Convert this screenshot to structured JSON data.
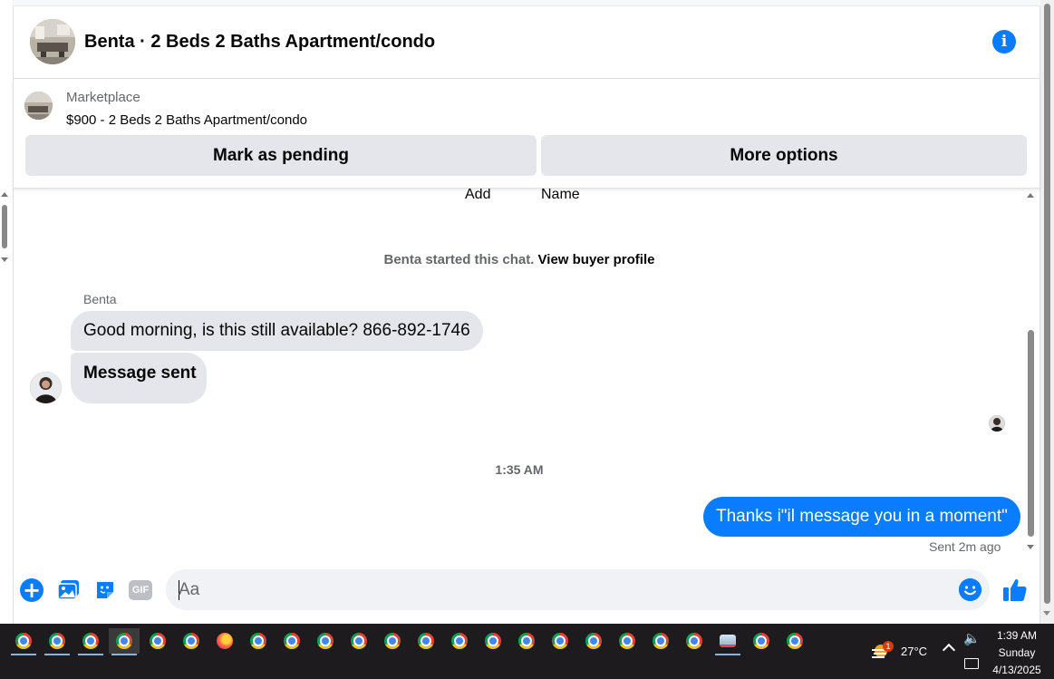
{
  "header": {
    "title": "Benta · 2 Beds 2 Baths Apartment/condo"
  },
  "listing": {
    "source": "Marketplace",
    "price_title": "$900 - 2 Beds 2 Baths Apartment/condo",
    "mark_pending_label": "Mark as pending",
    "more_options_label": "More options"
  },
  "conversation": {
    "cut_labels": [
      "Add",
      "Name"
    ],
    "chat_started_text": "Benta started this chat.",
    "view_profile_link": "View buyer profile",
    "sender_name": "Benta",
    "incoming": [
      "Good morning, is this still available? 866-892-1746",
      "Message sent"
    ],
    "timestamp": "1:35 AM",
    "outgoing": "Thanks i\"il message you in a moment\"",
    "sent_status": "Sent 2m ago"
  },
  "composer": {
    "placeholder": "Aa",
    "gif_label": "GIF"
  },
  "taskbar": {
    "badge_count": "1",
    "temperature": "27°C",
    "time": "1:39 AM",
    "day": "Sunday",
    "date": "4/13/2025"
  },
  "colors": {
    "accent": "#0a7cff",
    "bubble_incoming": "#e4e6eb",
    "taskbar": "#1e1b1e"
  }
}
